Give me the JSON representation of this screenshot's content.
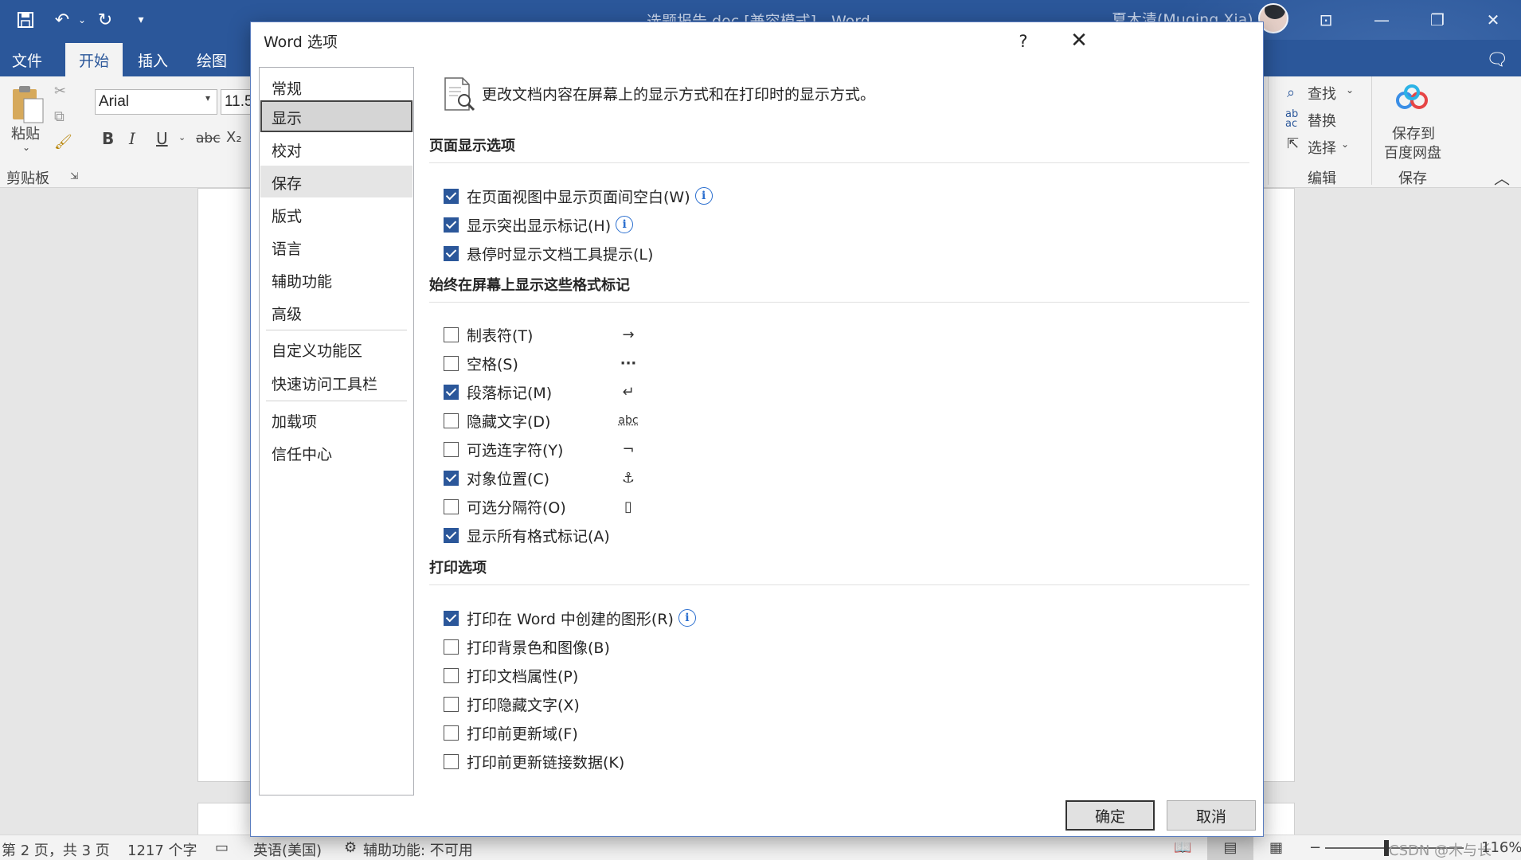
{
  "app": {
    "doc_title": "选题报告.doc [兼容模式] - Word",
    "user_name": "夏木清(Muqing Xia)"
  },
  "ribbon": {
    "tabs": [
      "文件",
      "开始",
      "插入",
      "绘图"
    ],
    "active_tab": "开始",
    "paste_label": "粘贴",
    "clipboard_group": "剪贴板",
    "font_name": "Arial",
    "font_size": "11.5",
    "bold": "B",
    "italic": "I",
    "underline": "U",
    "strike": "abc",
    "subscript": "X₂",
    "find_label": "查找",
    "replace_label": "替换",
    "select_label": "选择",
    "edit_group": "编辑",
    "save_cloud_line1": "保存到",
    "save_cloud_line2": "百度网盘",
    "save_group": "保存"
  },
  "statusbar": {
    "page_info": "第 2 页，共 3 页",
    "word_count": "1217 个字",
    "language": "英语(美国)",
    "accessibility": "辅助功能: 不可用",
    "watermark": "CSDN @木与长",
    "zoom": "116%"
  },
  "dialog": {
    "title": "Word 选项",
    "help": "?",
    "close": "✕",
    "nav": [
      {
        "label": "常规"
      },
      {
        "label": "显示"
      },
      {
        "label": "校对"
      },
      {
        "label": "保存"
      },
      {
        "label": "版式"
      },
      {
        "label": "语言"
      },
      {
        "label": "辅助功能"
      },
      {
        "label": "高级"
      },
      {
        "label": "自定义功能区"
      },
      {
        "label": "快速访问工具栏"
      },
      {
        "label": "加载项"
      },
      {
        "label": "信任中心"
      }
    ],
    "selected_nav": "显示",
    "description": "更改文档内容在屏幕上的显示方式和在打印时的显示方式。",
    "sections": {
      "page_display": {
        "title": "页面显示选项",
        "options": [
          {
            "label": "在页面视图中显示页面间空白(W)",
            "checked": true
          },
          {
            "label": "显示突出显示标记(H)",
            "checked": true
          },
          {
            "label": "悬停时显示文档工具提示(L)",
            "checked": true
          }
        ]
      },
      "format_marks": {
        "title": "始终在屏幕上显示这些格式标记",
        "options": [
          {
            "label": "制表符(T)",
            "checked": false,
            "symbol": "→"
          },
          {
            "label": "空格(S)",
            "checked": false,
            "symbol": "···"
          },
          {
            "label": "段落标记(M)",
            "checked": true,
            "symbol": "↵"
          },
          {
            "label": "隐藏文字(D)",
            "checked": false,
            "symbol": "abc"
          },
          {
            "label": "可选连字符(Y)",
            "checked": false,
            "symbol": "¬"
          },
          {
            "label": "对象位置(C)",
            "checked": true,
            "symbol": "⚓"
          },
          {
            "label": "可选分隔符(O)",
            "checked": false,
            "symbol": "▯"
          },
          {
            "label": "显示所有格式标记(A)",
            "checked": true
          }
        ]
      },
      "print": {
        "title": "打印选项",
        "options": [
          {
            "label": "打印在 Word 中创建的图形(R)",
            "checked": true
          },
          {
            "label": "打印背景色和图像(B)",
            "checked": false
          },
          {
            "label": "打印文档属性(P)",
            "checked": false
          },
          {
            "label": "打印隐藏文字(X)",
            "checked": false
          },
          {
            "label": "打印前更新域(F)",
            "checked": false
          },
          {
            "label": "打印前更新链接数据(K)",
            "checked": false
          }
        ]
      }
    },
    "ok_button": "确定",
    "cancel_button": "取消"
  }
}
